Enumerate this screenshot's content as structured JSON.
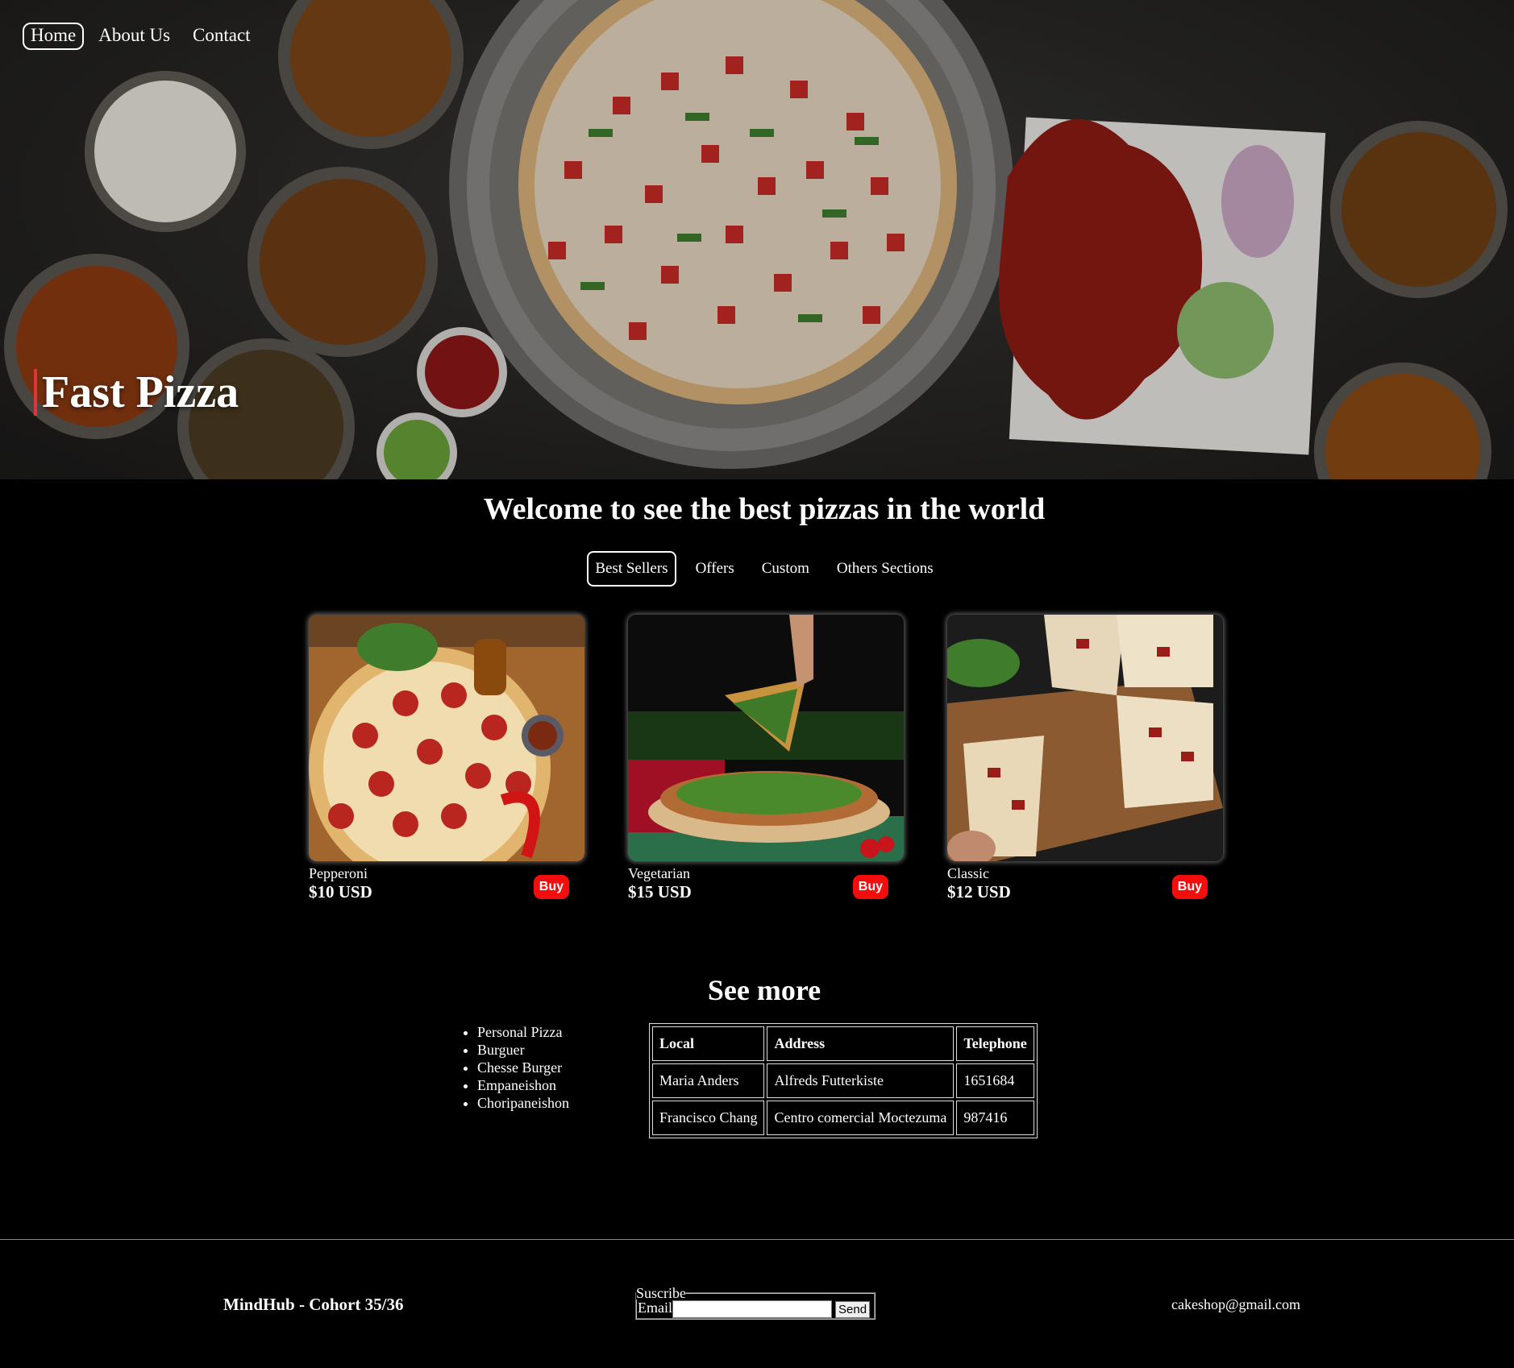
{
  "nav": {
    "items": [
      {
        "label": "Home",
        "active": true
      },
      {
        "label": "About Us"
      },
      {
        "label": "Contact"
      }
    ]
  },
  "hero": {
    "title": "Fast Pizza"
  },
  "main": {
    "welcome": "Welcome to see the best pizzas in the world",
    "tabs": [
      {
        "label": "Best Sellers",
        "active": true
      },
      {
        "label": "Offers"
      },
      {
        "label": "Custom"
      },
      {
        "label": "Others Sections"
      }
    ],
    "products": [
      {
        "name": "Pepperoni",
        "price": "$10 USD",
        "buy": "Buy"
      },
      {
        "name": "Vegetarian",
        "price": "$15 USD",
        "buy": "Buy"
      },
      {
        "name": "Classic",
        "price": "$12 USD",
        "buy": "Buy"
      }
    ],
    "see_more": "See more",
    "menu_list": [
      "Personal Pizza",
      "Burguer",
      "Chesse Burger",
      "Empaneishon",
      "Choripaneishon"
    ],
    "table": {
      "headers": [
        "Local",
        "Address",
        "Telephone"
      ],
      "rows": [
        [
          "Maria Anders",
          "Alfreds Futterkiste",
          "1651684"
        ],
        [
          "Francisco Chang",
          "Centro comercial Moctezuma",
          "987416"
        ]
      ]
    }
  },
  "footer": {
    "brand": "MindHub - Cohort 35/36",
    "subscribe": {
      "legend": "Suscribe",
      "label": "Email",
      "button": "Send"
    },
    "email": "cakeshop@gmail.com"
  },
  "colors": {
    "background": "#000000",
    "buy_button": "#f30d0d",
    "hero_accent": "#e0333a"
  }
}
